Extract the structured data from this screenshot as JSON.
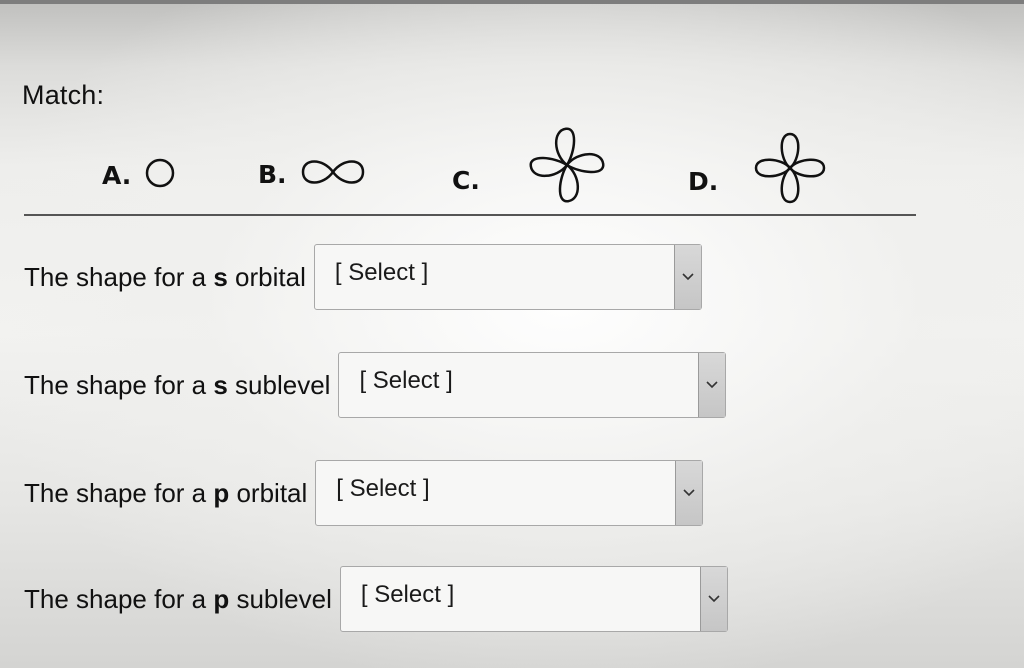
{
  "title": "Match:",
  "options": [
    {
      "letter": "A.",
      "icon": "circle-orbital-icon"
    },
    {
      "letter": "B.",
      "icon": "dumbbell-orbital-icon"
    },
    {
      "letter": "C.",
      "icon": "four-lobe-orbital-icon"
    },
    {
      "letter": "D.",
      "icon": "cloverleaf-orbital-icon"
    }
  ],
  "questions": [
    {
      "pre": "The shape for a ",
      "bold": "s",
      "post": " orbital",
      "select_value": "[ Select ]"
    },
    {
      "pre": "The shape for a ",
      "bold": "s",
      "post": " sublevel",
      "select_value": "[ Select ]"
    },
    {
      "pre": "The shape for a ",
      "bold": "p",
      "post": " orbital",
      "select_value": "[ Select ]"
    },
    {
      "pre": "The shape for a ",
      "bold": "p",
      "post": " sublevel",
      "select_value": "[ Select ]"
    }
  ]
}
